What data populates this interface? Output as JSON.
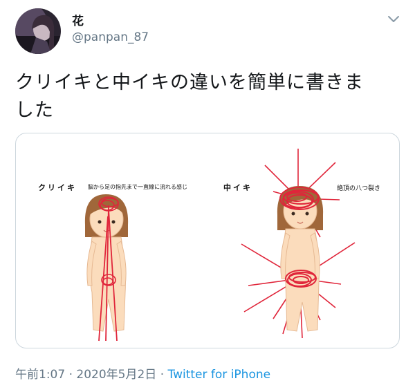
{
  "author": {
    "display_name": "花",
    "handle": "@panpan_87"
  },
  "tweet": {
    "text_line1": "クリイキと中イキの違いを簡単に書きま",
    "text_line2": "した"
  },
  "image": {
    "left_title": "クリイキ",
    "left_caption": "脳から足の指先まで一直線に流れる感じ",
    "right_title": "中イキ",
    "right_caption": "絶頂の八つ裂き"
  },
  "meta": {
    "time": "午前1:07",
    "sep1": " · ",
    "date": "2020年5月2日",
    "sep2": " · ",
    "source": "Twitter for iPhone"
  },
  "icons": {
    "menu": "chevron-down-icon"
  },
  "colors": {
    "link": "#1b95e0",
    "muted": "#657786",
    "scribble": "#e0253a",
    "skin": "#fbdcbc",
    "hair": "#a0673a"
  }
}
